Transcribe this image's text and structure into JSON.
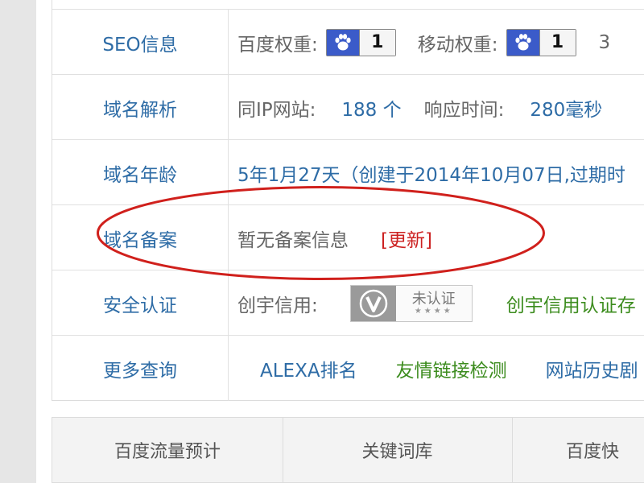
{
  "rows": {
    "seo": {
      "label": "SEO信息",
      "baidu_weight_label": "百度权重:",
      "baidu_weight_value": "1",
      "mobile_weight_label": "移动权重:",
      "mobile_weight_value": "1",
      "cut_text": "3"
    },
    "dns": {
      "label": "域名解析",
      "same_ip_label": "同IP网站:",
      "same_ip_value": "188 个",
      "response_label": "响应时间:",
      "response_value": "280毫秒"
    },
    "age": {
      "label": "域名年龄",
      "value": "5年1月27天（创建于2014年10月07日,过期时"
    },
    "icp": {
      "label": "域名备案",
      "status": "暂无备案信息",
      "update_link": "[更新]"
    },
    "security": {
      "label": "安全认证",
      "cy_label": "创宇信用:",
      "badge_text": "未认证",
      "badge_dots": "★★★★",
      "cert_link": "创宇信用认证存"
    },
    "more": {
      "label": "更多查询",
      "links": [
        "ALEXA排名",
        "友情链接检测",
        "网站历史剧"
      ]
    }
  },
  "tabs": [
    "百度流量预计",
    "关键词库",
    "百度快"
  ],
  "colors": {
    "label_blue": "#2e6ca6",
    "link_red": "#cc2222",
    "link_green": "#3c8c1e",
    "paw_badge": "#3b5bc9",
    "annotation_red": "#d0201c"
  },
  "icons": {
    "baidu_paw": "paw-icon",
    "cert_v": "v-shield-icon"
  }
}
